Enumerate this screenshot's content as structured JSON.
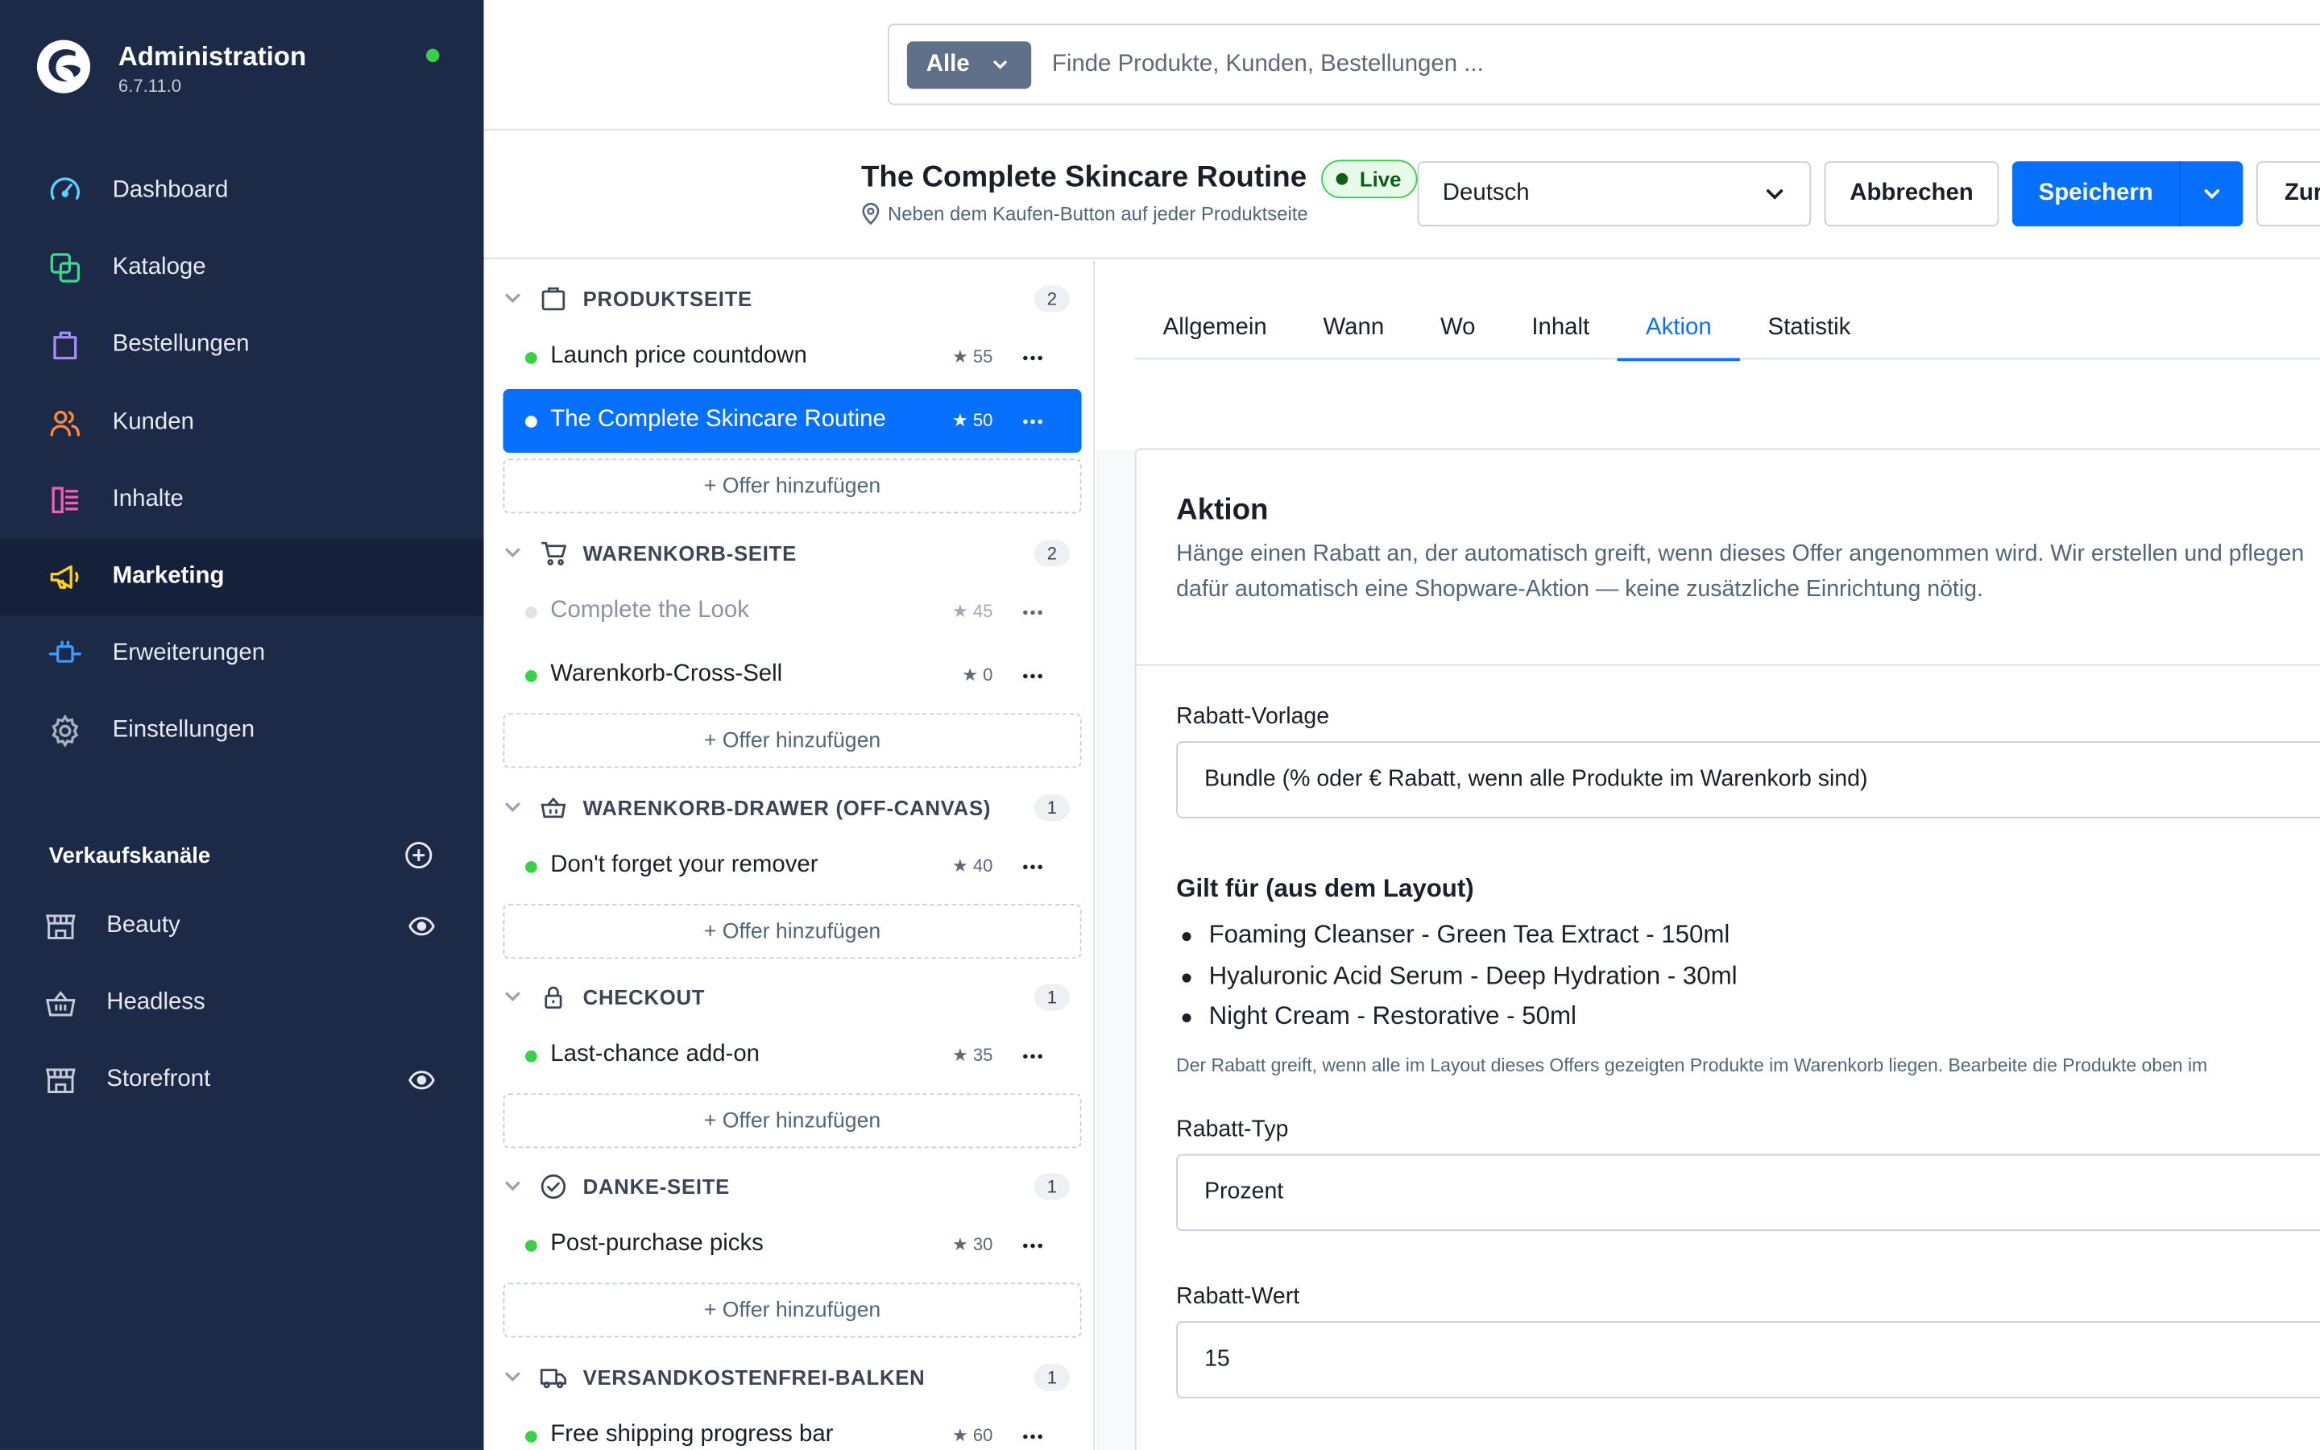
{
  "app": {
    "name": "Administration",
    "version": "6.7.11.0",
    "status_color": "#37d046"
  },
  "nav": [
    {
      "id": "dashboard",
      "label": "Dashboard",
      "icon": "dashboard-icon",
      "color": "#5ad1ff",
      "active": false
    },
    {
      "id": "kataloge",
      "label": "Kataloge",
      "icon": "catalog-icon",
      "color": "#3fd78f",
      "active": false
    },
    {
      "id": "bestellungen",
      "label": "Bestellungen",
      "icon": "shopping-bag-icon",
      "color": "#a68cf5",
      "active": false
    },
    {
      "id": "kunden",
      "label": "Kunden",
      "icon": "customers-icon",
      "color": "#ff8a3d",
      "active": false
    },
    {
      "id": "inhalte",
      "label": "Inhalte",
      "icon": "content-icon",
      "color": "#ff5ab6",
      "active": false
    },
    {
      "id": "marketing",
      "label": "Marketing",
      "icon": "megaphone-icon",
      "color": "#ffd21e",
      "active": true
    },
    {
      "id": "erweiterungen",
      "label": "Erweiterungen",
      "icon": "plug-icon",
      "color": "#3d9bff",
      "active": false
    },
    {
      "id": "einstellungen",
      "label": "Einstellungen",
      "icon": "gear-icon",
      "color": "#a8b1bf",
      "active": false
    }
  ],
  "channels": {
    "heading": "Verkaufskanäle",
    "items": [
      {
        "label": "Beauty",
        "icon": "storefront-icon",
        "visible_icon": true
      },
      {
        "label": "Headless",
        "icon": "basket-icon",
        "visible_icon": false
      },
      {
        "label": "Storefront",
        "icon": "storefront-icon",
        "visible_icon": true
      }
    ]
  },
  "search": {
    "scope": "Alle",
    "placeholder": "Finde Produkte, Kunden, Bestellungen ..."
  },
  "header": {
    "title": "The Complete Skincare Routine",
    "status": "Live",
    "subtitle": "Neben dem Kaufen-Button auf jeder Produktseite",
    "language": "Deutsch",
    "cancel_label": "Abbrechen",
    "save_label": "Speichern",
    "back_label": "Zur"
  },
  "sections": [
    {
      "title": "PRODUKTSEITE",
      "icon": "product-page-icon",
      "count": "2",
      "offers": [
        {
          "name": "Launch price countdown",
          "priority": "★ 55",
          "active": true,
          "selected": false
        },
        {
          "name": "The Complete Skincare Routine",
          "priority": "★ 50",
          "active": true,
          "selected": true
        }
      ]
    },
    {
      "title": "WARENKORB-SEITE",
      "icon": "cart-icon",
      "count": "2",
      "offers": [
        {
          "name": "Complete the Look",
          "priority": "★ 45",
          "active": false,
          "selected": false
        },
        {
          "name": "Warenkorb-Cross-Sell",
          "priority": "★ 0",
          "active": true,
          "selected": false
        }
      ]
    },
    {
      "title": "WARENKORB-DRAWER (OFF-CANVAS)",
      "icon": "basket-icon",
      "count": "1",
      "offers": [
        {
          "name": "Don't forget your remover",
          "priority": "★ 40",
          "active": true,
          "selected": false
        }
      ]
    },
    {
      "title": "CHECKOUT",
      "icon": "lock-icon",
      "count": "1",
      "offers": [
        {
          "name": "Last-chance add-on",
          "priority": "★ 35",
          "active": true,
          "selected": false
        }
      ]
    },
    {
      "title": "DANKE-SEITE",
      "icon": "check-circle-icon",
      "count": "1",
      "offers": [
        {
          "name": "Post-purchase picks",
          "priority": "★ 30",
          "active": true,
          "selected": false
        }
      ]
    },
    {
      "title": "VERSANDKOSTENFREI-BALKEN",
      "icon": "truck-icon",
      "count": "1",
      "offers": [
        {
          "name": "Free shipping progress bar",
          "priority": "★ 60",
          "active": true,
          "selected": false
        }
      ]
    }
  ],
  "add_offer_label": "+ Offer hinzufügen",
  "tabs": [
    {
      "label": "Allgemein",
      "active": false
    },
    {
      "label": "Wann",
      "active": false
    },
    {
      "label": "Wo",
      "active": false
    },
    {
      "label": "Inhalt",
      "active": false
    },
    {
      "label": "Aktion",
      "active": true
    },
    {
      "label": "Statistik",
      "active": false
    }
  ],
  "action": {
    "title": "Aktion",
    "description": "Hänge einen Rabatt an, der automatisch greift, wenn dieses Offer angenommen wird. Wir erstellen und pflegen dafür automatisch eine Shopware-Aktion — keine zusätzliche Einrichtung nötig.",
    "template_label": "Rabatt-Vorlage",
    "template_value": "Bundle (% oder € Rabatt, wenn alle Produkte im Warenkorb sind)",
    "applies_title": "Gilt für (aus dem Layout)",
    "applies_items": [
      "Foaming Cleanser - Green Tea Extract - 150ml",
      "Hyaluronic Acid Serum - Deep Hydration - 30ml",
      "Night Cream - Restorative - 50ml"
    ],
    "applies_hint": "Der Rabatt greift, wenn alle im Layout dieses Offers gezeigten Produkte im Warenkorb liegen. Bearbeite die Produkte oben im",
    "type_label": "Rabatt-Typ",
    "type_value": "Prozent",
    "value_label": "Rabatt-Wert",
    "value_value": "15"
  },
  "colors": {
    "sidebar": "#1d2a47",
    "sidebar_active": "#15203a",
    "primary": "#0870ff",
    "live_green": "#37d046"
  }
}
